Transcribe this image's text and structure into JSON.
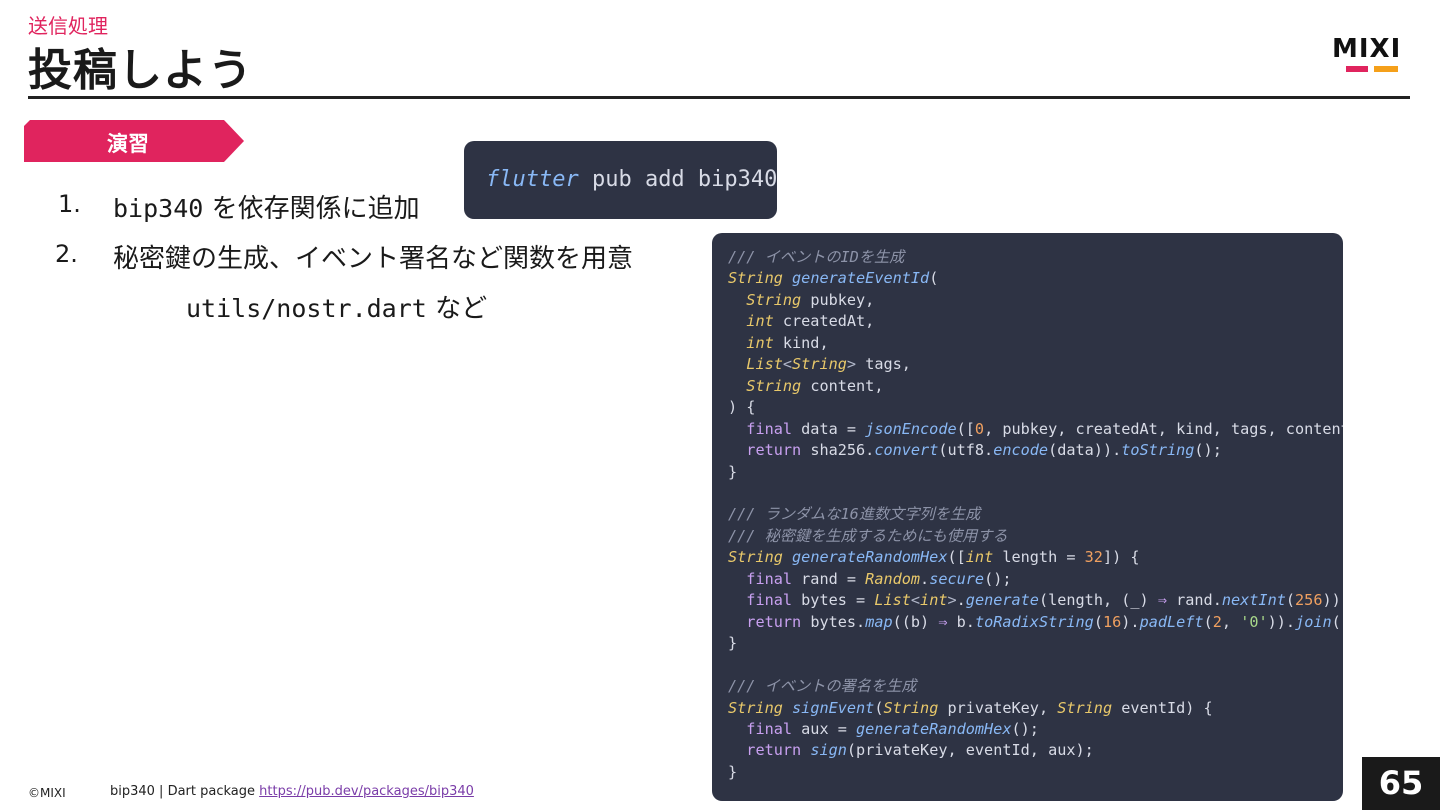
{
  "header": {
    "subtitle": "送信処理",
    "title": "投稿しよう",
    "logo_text": "MIXI"
  },
  "tag": {
    "label": "演習"
  },
  "steps": [
    {
      "num": "1.",
      "code": "bip340",
      "text": " を依存関係に追加"
    },
    {
      "num": "2.",
      "text": "秘密鍵の生成、イベント署名など関数を用意"
    }
  ],
  "sub_note": {
    "code": "utils/nostr.dart",
    "text": " など"
  },
  "command": {
    "cmd": "flutter",
    "args": " pub add bip340"
  },
  "footer": {
    "copyright": "©MIXI",
    "source_text": "bip340 | Dart package ",
    "source_link": "https://pub.dev/packages/bip340"
  },
  "page_number": "65",
  "colors": {
    "accent": "#e0245e",
    "orange": "#f5a01a",
    "code_bg": "#2e3344"
  }
}
